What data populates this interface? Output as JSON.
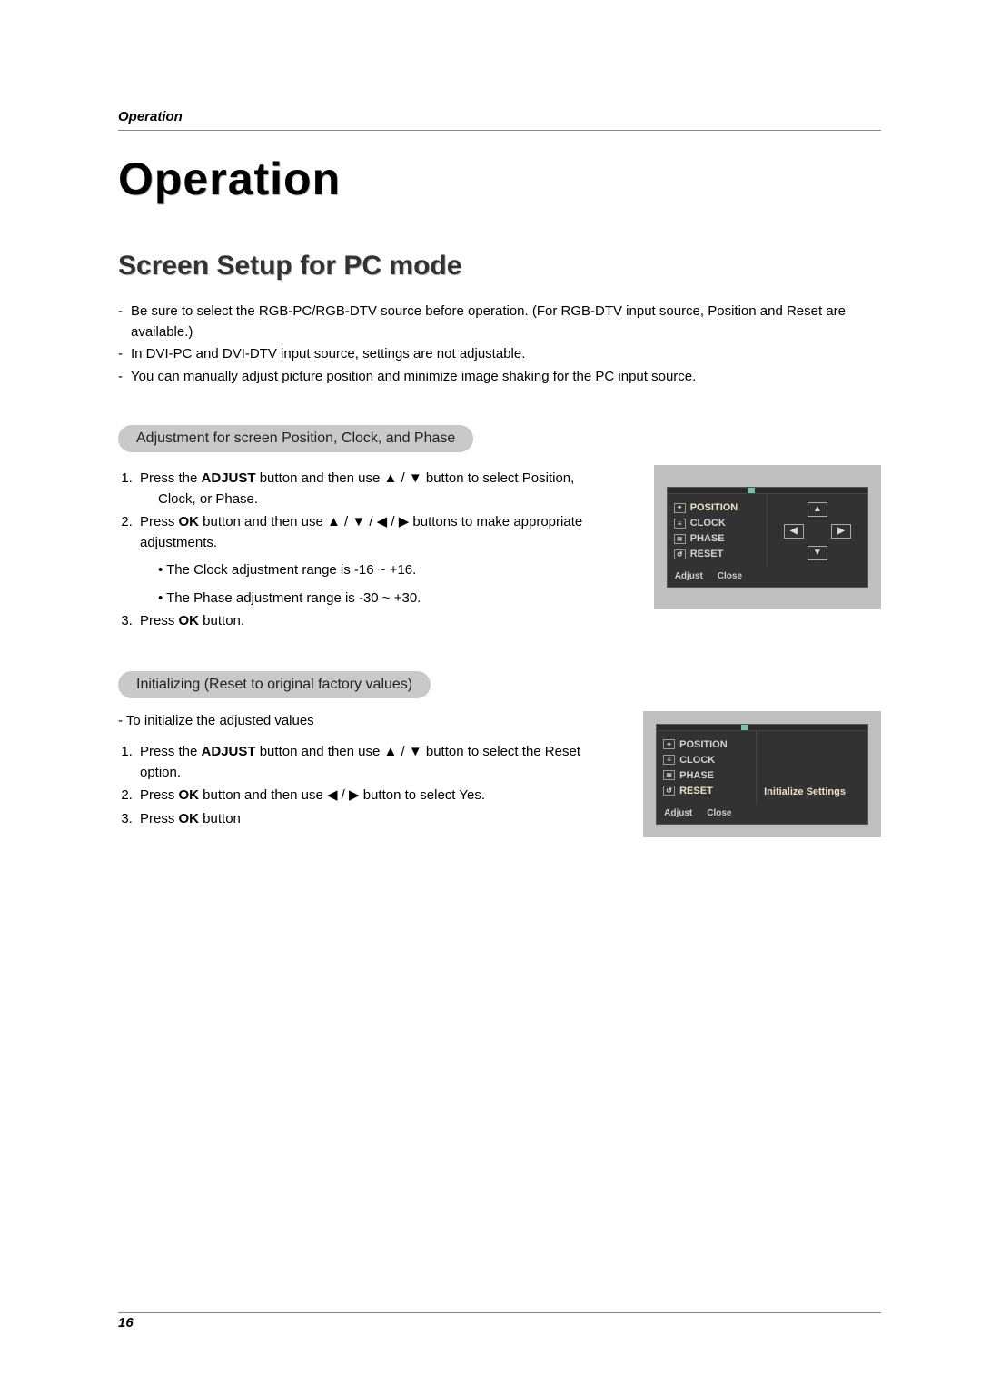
{
  "running_head": "Operation",
  "title_main": "Operation",
  "title_sub": "Screen Setup for PC mode",
  "intro_bullets": [
    "Be sure to select the RGB-PC/RGB-DTV source before operation. (For RGB-DTV input source, Position and Reset are available.)",
    "In DVI-PC and DVI-DTV input source, settings are not adjustable.",
    "You can manually adjust picture position and minimize image shaking for the PC input source."
  ],
  "section1": {
    "pill": "Adjustment for screen Position, Clock, and Phase",
    "step1_a": "Press the ",
    "step1_bold": "ADJUST",
    "step1_b": " button and then use ",
    "arrow_ud": "▲ / ▼",
    "step1_c": " button to select ",
    "step1_opt1": "Position",
    "step1_sep": ", ",
    "step1_opt2": "Clock",
    "step1_or": ", or ",
    "step1_opt3": "Phase",
    "step1_end": ".",
    "step2_a": "Press ",
    "step2_bold": "OK",
    "step2_b": " button and then use ",
    "arrow_all": "▲ / ▼ / ◀ / ▶",
    "step2_c": " buttons to make appropriate adjustments.",
    "note1_a": "• The ",
    "note1_item": "Clock",
    "note1_b": " adjustment range is -16 ~ +16.",
    "note2_a": "• The ",
    "note2_item": "Phase",
    "note2_b": " adjustment range is -30 ~ +30.",
    "step3_a": "Press ",
    "step3_bold": "OK",
    "step3_b": " button."
  },
  "section2": {
    "pill": "Initializing (Reset to original factory values)",
    "lead_dash": "-  To initialize the adjusted values",
    "step1_a": "Press the ",
    "step1_bold": "ADJUST",
    "step1_b": " button and then use ",
    "arrow_ud": "▲ / ▼",
    "step1_c": " button to select the ",
    "step1_opt": "Reset",
    "step1_d": " option.",
    "step2_a": "Press ",
    "step2_bold": "OK",
    "step2_b": " button and then use ",
    "arrow_lr": "◀ / ▶",
    "step2_c": " button to select ",
    "step2_opt": "Yes",
    "step2_d": ".",
    "step3_a": "Press ",
    "step3_bold": "OK",
    "step3_b": " button"
  },
  "osd": {
    "items": [
      "POSITION",
      "CLOCK",
      "PHASE",
      "RESET"
    ],
    "foot_adjust": "Adjust",
    "foot_close": "Close",
    "right_label": "Initialize Settings",
    "arrows": {
      "up": "▲",
      "down": "▼",
      "left": "◀",
      "right": "▶"
    }
  },
  "page_number": "16"
}
